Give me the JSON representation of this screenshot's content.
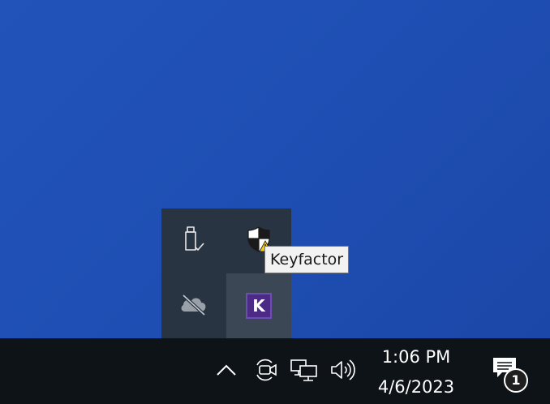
{
  "tray_overflow": {
    "items": [
      {
        "name": "Safely Remove Hardware and Eject Media",
        "icon": "usb-drive-icon"
      },
      {
        "name": "Windows Security",
        "icon": "shield-warning-icon"
      },
      {
        "name": "OneDrive",
        "icon": "onedrive-offline-icon"
      },
      {
        "name": "Keyfactor",
        "icon": "keyfactor-icon",
        "glyph": "K",
        "hovered": true
      }
    ]
  },
  "tooltip": {
    "text": "Keyfactor"
  },
  "taskbar": {
    "icons": [
      "show-hidden-icons-chevron-icon",
      "meet-now-camera-icon",
      "network-icon",
      "volume-icon"
    ]
  },
  "clock": {
    "time": "1:06 PM",
    "date": "4/6/2023"
  },
  "notifications": {
    "icon": "action-center-icon",
    "count": "1"
  },
  "colors": {
    "desktop": "#1f4fb4",
    "taskbar": "#0e1318",
    "flyout": "#293442",
    "keyfactor_purple": "#4b2b86",
    "warning_yellow": "#f2c811"
  }
}
